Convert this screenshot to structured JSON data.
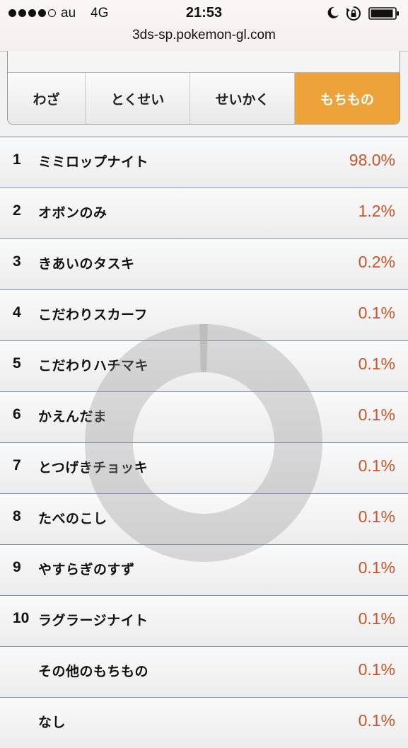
{
  "status_bar": {
    "carrier": "au",
    "network": "4G",
    "time": "21:53",
    "signal_bars_filled": 4,
    "signal_bars_total": 5,
    "icons": [
      "moon-icon",
      "rotation-lock-icon",
      "battery-icon"
    ]
  },
  "browser": {
    "url": "3ds-sp.pokemon-gl.com"
  },
  "tabs": [
    {
      "label": "わざ",
      "active": false
    },
    {
      "label": "とくせい",
      "active": false
    },
    {
      "label": "せいかく",
      "active": false
    },
    {
      "label": "もちもの",
      "active": true
    }
  ],
  "colors": {
    "active_tab": "#eea33a",
    "percent_text": "#c9542a",
    "row_divider": "#7f93b0"
  },
  "ranking": [
    {
      "rank": "1",
      "name": "ミミロップナイト",
      "percent": "98.0%"
    },
    {
      "rank": "2",
      "name": "オボンのみ",
      "percent": "1.2%"
    },
    {
      "rank": "3",
      "name": "きあいのタスキ",
      "percent": "0.2%"
    },
    {
      "rank": "4",
      "name": "こだわりスカーフ",
      "percent": "0.1%"
    },
    {
      "rank": "5",
      "name": "こだわりハチマキ",
      "percent": "0.1%"
    },
    {
      "rank": "6",
      "name": "かえんだま",
      "percent": "0.1%"
    },
    {
      "rank": "7",
      "name": "とつげきチョッキ",
      "percent": "0.1%"
    },
    {
      "rank": "8",
      "name": "たべのこし",
      "percent": "0.1%"
    },
    {
      "rank": "9",
      "name": "やすらぎのすず",
      "percent": "0.1%"
    },
    {
      "rank": "10",
      "name": "ラグラージナイト",
      "percent": "0.1%"
    },
    {
      "rank": "",
      "name": "その他のもちもの",
      "percent": "0.1%"
    },
    {
      "rank": "",
      "name": "なし",
      "percent": "0.1%"
    }
  ]
}
